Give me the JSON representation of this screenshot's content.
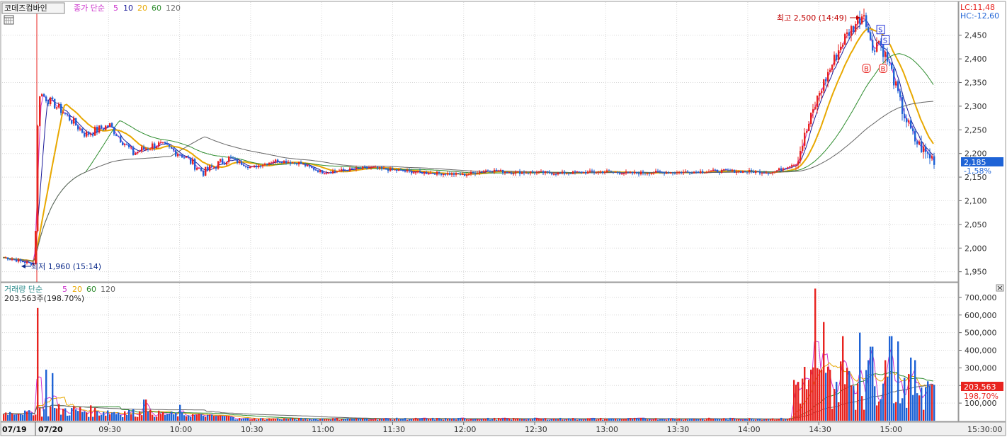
{
  "header": {
    "stock_name": "코데즈컴바인",
    "price_legend": [
      "종가 단순",
      "5",
      "10",
      "20",
      "60",
      "120"
    ],
    "volume_legend": [
      "거래량 단순",
      "5",
      "20",
      "60",
      "120"
    ],
    "volume_info": "203,563주(198.70%)"
  },
  "colors": {
    "up": "#e8231f",
    "down": "#1e63d6",
    "ma5": "#cc33cc",
    "ma10": "#1a1a99",
    "ma20": "#e8a800",
    "ma60": "#2d8c2d",
    "ma120": "#666666",
    "grid": "#d8d8d8"
  },
  "icons": [
    "calendar-icon",
    "close-icon"
  ],
  "chart_data": [
    {
      "type": "candlestick",
      "title": "코데즈컴바인",
      "ylim": [
        1930,
        2520
      ],
      "y_ticks": [
        "1,950",
        "2,000",
        "2,050",
        "2,100",
        "2,150",
        "2,200",
        "2,250",
        "2,300",
        "2,350",
        "2,400",
        "2,450"
      ],
      "x_ticks": [
        "07/19",
        "07/20",
        "09:30",
        "10:00",
        "10:30",
        "11:00",
        "11:30",
        "12:00",
        "12:30",
        "13:00",
        "13:30",
        "14:00",
        "14:30",
        "15:00",
        "15:30:00"
      ],
      "limit_labels": {
        "lc": "LC:11,48",
        "hc": "HC:-12,60"
      },
      "current_price": {
        "value": 2185,
        "label": "2,185",
        "change": "-1,58%"
      },
      "annotations": {
        "high": {
          "label": "최고 2,500 (14:49)",
          "value": 2500
        },
        "low": {
          "label": "최저 1,960 (15:14)",
          "value": 1960
        }
      },
      "signals": [
        {
          "label": "S",
          "time": "14:56",
          "value": 2462
        },
        {
          "label": "S",
          "time": "14:58",
          "value": 2440
        },
        {
          "label": "B",
          "time": "14:50",
          "value": 2380
        },
        {
          "label": "B",
          "time": "14:57",
          "value": 2380
        }
      ],
      "price_path": [
        [
          "07/19 open",
          1980
        ],
        [
          "07/19 close",
          1965
        ],
        [
          "09:00",
          2330
        ],
        [
          "09:10",
          2290
        ],
        [
          "09:20",
          2240
        ],
        [
          "09:30",
          2260
        ],
        [
          "09:40",
          2200
        ],
        [
          "09:50",
          2220
        ],
        [
          "10:00",
          2200
        ],
        [
          "10:10",
          2160
        ],
        [
          "10:20",
          2190
        ],
        [
          "10:30",
          2170
        ],
        [
          "10:40",
          2185
        ],
        [
          "10:50",
          2180
        ],
        [
          "11:00",
          2160
        ],
        [
          "11:10",
          2165
        ],
        [
          "11:20",
          2170
        ],
        [
          "11:30",
          2165
        ],
        [
          "11:40",
          2160
        ],
        [
          "11:50",
          2158
        ],
        [
          "12:00",
          2155
        ],
        [
          "12:10",
          2165
        ],
        [
          "12:20",
          2160
        ],
        [
          "12:30",
          2160
        ],
        [
          "12:40",
          2158
        ],
        [
          "12:50",
          2160
        ],
        [
          "13:00",
          2162
        ],
        [
          "13:10",
          2158
        ],
        [
          "13:20",
          2160
        ],
        [
          "13:30",
          2160
        ],
        [
          "13:40",
          2162
        ],
        [
          "13:50",
          2163
        ],
        [
          "14:00",
          2162
        ],
        [
          "14:10",
          2160
        ],
        [
          "14:20",
          2180
        ],
        [
          "14:30",
          2330
        ],
        [
          "14:40",
          2440
        ],
        [
          "14:49",
          2500
        ],
        [
          "14:52",
          2420
        ],
        [
          "14:55",
          2440
        ],
        [
          "15:00",
          2380
        ],
        [
          "15:05",
          2290
        ],
        [
          "15:10",
          2230
        ],
        [
          "15:15",
          2200
        ],
        [
          "15:19",
          2185
        ]
      ],
      "moving_averages": [
        "MA5",
        "MA10",
        "MA20",
        "MA60",
        "MA120"
      ]
    },
    {
      "type": "bar",
      "title": "거래량",
      "ylim": [
        0,
        780000
      ],
      "y_ticks": [
        "100,000",
        "200,000",
        "300,000",
        "400,000",
        "500,000",
        "600,000",
        "700,000"
      ],
      "current_volume": {
        "label": "203,563",
        "ratio": "198,70%"
      },
      "volume_peaks": [
        [
          "09:00",
          640000
        ],
        [
          "09:03",
          290000
        ],
        [
          "09:06",
          270000
        ],
        [
          "09:45",
          120000
        ],
        [
          "10:00",
          90000
        ],
        [
          "14:28",
          750000
        ],
        [
          "14:32",
          560000
        ],
        [
          "14:40",
          480000
        ],
        [
          "14:47",
          500000
        ],
        [
          "14:52",
          420000
        ],
        [
          "15:00",
          480000
        ],
        [
          "15:03",
          450000
        ],
        [
          "15:18",
          203563
        ]
      ]
    }
  ]
}
